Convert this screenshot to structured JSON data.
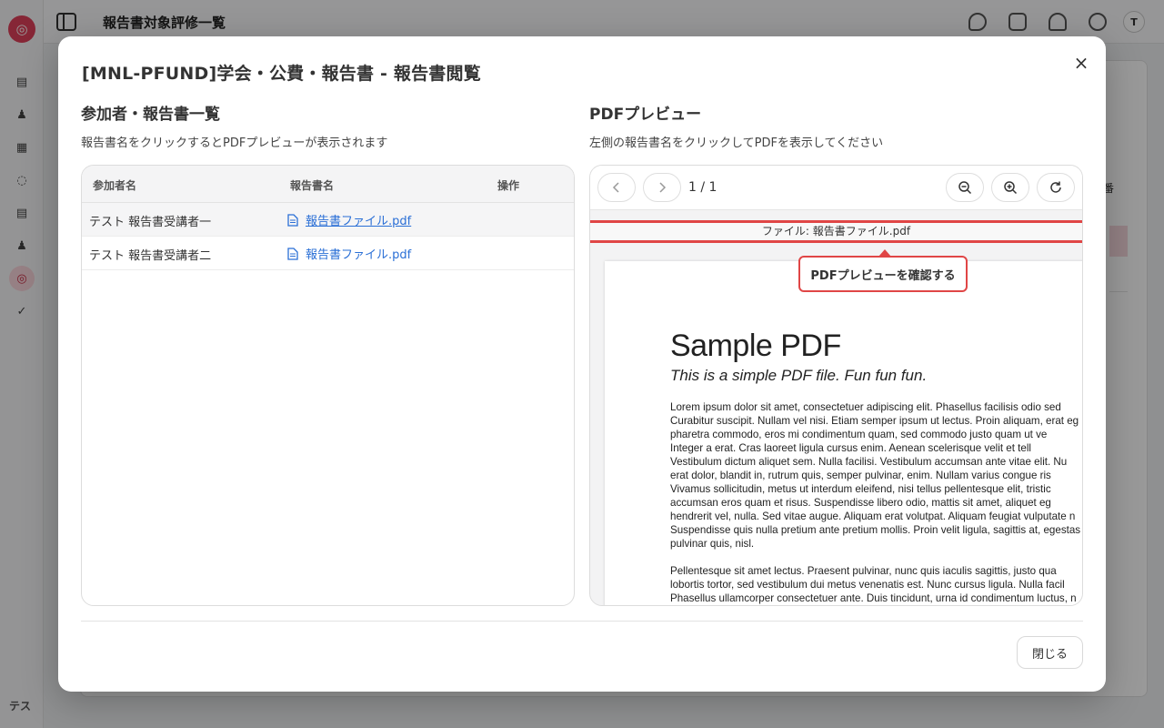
{
  "app": {
    "page_title": "報告書対象評修一覧",
    "user_initials": "テス",
    "avatar_initial": "T",
    "bg_button_fragment": "番",
    "logo_glyph": "◎",
    "sidebar_glyphs": [
      "▤",
      "♟",
      "▦",
      "◌",
      "▤",
      "♟",
      "◎",
      "✓"
    ]
  },
  "modal": {
    "title": "[MNL-PFUND]学会・公費・報告書 - 報告書閲覧",
    "close_icon": "×",
    "left": {
      "title": "参加者・報告書一覧",
      "subtitle": "報告書名をクリックするとPDFプレビューが表示されます",
      "columns": [
        "参加者名",
        "報告書名",
        "操作"
      ],
      "rows": [
        {
          "name": "テスト 報告書受講者一",
          "file": "報告書ファイル.pdf",
          "selected": true
        },
        {
          "name": "テスト 報告書受講者二",
          "file": "報告書ファイル.pdf",
          "selected": false
        }
      ]
    },
    "right": {
      "title": "PDFプレビュー",
      "subtitle": "左側の報告書名をクリックしてPDFを表示してください",
      "page_info": "1 / 1",
      "file_banner": "ファイル: 報告書ファイル.pdf",
      "callout": "PDFプレビューを確認する",
      "pdf": {
        "heading": "Sample PDF",
        "subheading": "This is a simple PDF file. Fun fun fun.",
        "para1": "Lorem ipsum dolor sit amet, consectetuer adipiscing elit. Phasellus facilisis odio sed\nCurabitur suscipit. Nullam vel nisi. Etiam semper ipsum ut lectus. Proin aliquam, erat eg\npharetra commodo, eros mi condimentum quam, sed commodo justo quam ut ve\nInteger a erat. Cras laoreet ligula cursus enim. Aenean scelerisque velit et tell\nVestibulum dictum aliquet sem. Nulla facilisi. Vestibulum accumsan ante vitae elit. Nu\nerat dolor, blandit in, rutrum quis, semper pulvinar, enim. Nullam varius congue ris\nVivamus sollicitudin, metus ut interdum eleifend, nisi tellus pellentesque elit, tristic\naccumsan eros quam et risus. Suspendisse libero odio, mattis sit amet, aliquet eg\nhendrerit vel, nulla. Sed vitae augue. Aliquam erat volutpat. Aliquam feugiat vulputate n\nSuspendisse quis nulla pretium ante pretium mollis. Proin velit ligula, sagittis at, egestas\npulvinar quis, nisl.",
        "para2": "Pellentesque sit amet lectus. Praesent pulvinar, nunc quis iaculis sagittis, justo qua\nlobortis tortor, sed vestibulum dui metus venenatis est. Nunc cursus ligula. Nulla facil\nPhasellus ullamcorper consectetuer ante. Duis tincidunt, urna id condimentum luctus, n"
      }
    },
    "footer": {
      "close_label": "閉じる"
    }
  },
  "colors": {
    "accent_red": "#e04646",
    "link_blue": "#2a6fd6",
    "brand_pink": "#e0405a"
  }
}
